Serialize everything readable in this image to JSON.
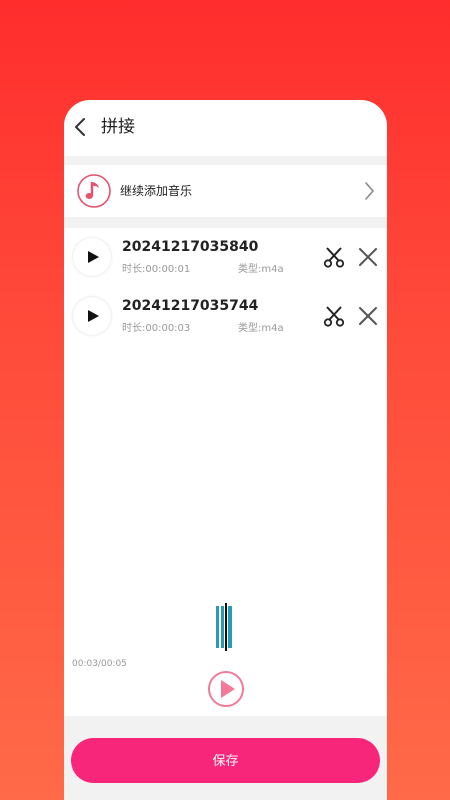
{
  "header": {
    "title": "拼接"
  },
  "add_music": {
    "label": "继续添加音乐"
  },
  "tracks": [
    {
      "name": "20241217035840",
      "duration": "时长:00:00:01",
      "type": "类型:m4a"
    },
    {
      "name": "20241217035744",
      "duration": "时长:00:00:03",
      "type": "类型:m4a"
    }
  ],
  "player": {
    "time": "00:03/00:05"
  },
  "footer": {
    "save_label": "保存"
  },
  "colors": {
    "accent": "#f8267a",
    "note_icon": "#e8506e",
    "waveform": "#2a9bb3",
    "background_top": "#ff2d2d",
    "background_bottom": "#ff6a48"
  },
  "icons": [
    "chevron-left-icon",
    "music-note-icon",
    "chevron-right-icon",
    "play-icon",
    "scissors-icon",
    "close-icon"
  ]
}
